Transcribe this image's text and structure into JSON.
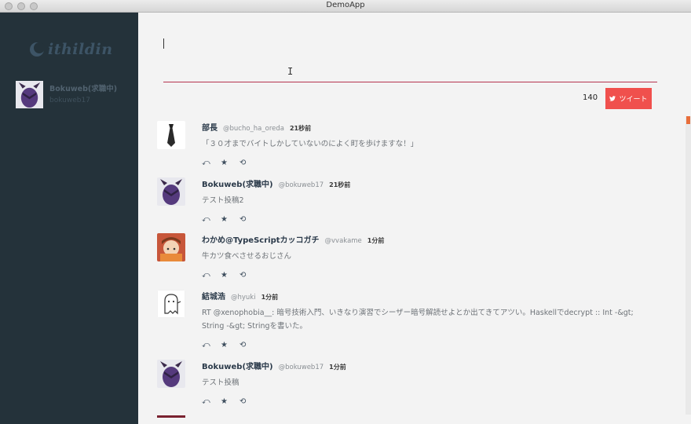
{
  "window": {
    "title": "DemoApp"
  },
  "sidebar": {
    "logo_text": "ithildin",
    "account": {
      "name": "Bokuweb(求職中)",
      "handle": "bokuweb17"
    }
  },
  "compose": {
    "char_count": "140",
    "tweet_button_label": "ツイート",
    "ibeam_glyph": "I"
  },
  "tweets": [
    {
      "name": "部長",
      "handle": "@bucho_ha_oreda",
      "time": "21秒前",
      "text": "「３０才までバイトしかしていないのによく町を歩けますな！」",
      "avatar": "tie"
    },
    {
      "name": "Bokuweb(求職中)",
      "handle": "@bokuweb17",
      "time": "21秒前",
      "text": "テスト投稿2",
      "avatar": "devil"
    },
    {
      "name": "わかめ@TypeScriptカッコガチ",
      "handle": "@vvakame",
      "time": "1分前",
      "text": "牛カツ食べさせるおじさん",
      "avatar": "anime"
    },
    {
      "name": "結城浩",
      "handle": "@hyuki",
      "time": "1分前",
      "text": "RT @xenophobia__: 暗号技術入門、いきなり演習でシーザー暗号解読せよとか出てきてアツい。Haskellでdecrypt :: Int -&gt; String -&gt; Stringを書いた。",
      "avatar": "ghost"
    },
    {
      "name": "Bokuweb(求職中)",
      "handle": "@bokuweb17",
      "time": "1分前",
      "text": "テスト投稿",
      "avatar": "devil"
    }
  ],
  "actions": {
    "reply": "⤺",
    "favorite": "★",
    "retweet": "⟲"
  },
  "colors": {
    "sidebar_bg": "#24323a",
    "accent": "#f0504d",
    "compose_underline": "#b5334f",
    "scroll_thumb": "#e86e3b"
  }
}
